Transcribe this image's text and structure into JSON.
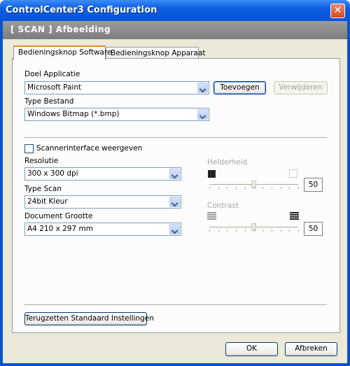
{
  "window": {
    "title": "ControlCenter3 Configuration",
    "close_glyph": "✕"
  },
  "header": {
    "text": "[ SCAN ]  Afbeelding"
  },
  "tabs": [
    {
      "label": "Bedieningsknop Software",
      "active": true
    },
    {
      "label": "Bedieningsknop Apparaat",
      "active": false
    }
  ],
  "target_app": {
    "label": "Doel Applicatie",
    "value": "Microsoft Paint",
    "add_button": "Toevoegen",
    "remove_button": "Verwijderen"
  },
  "file_type": {
    "label": "Type Bestand",
    "value": "Windows Bitmap (*.bmp)"
  },
  "scanner_interface": {
    "label": "Scannerinterface weergeven",
    "checked": false
  },
  "resolution": {
    "label": "Resolutie",
    "value": "300 x 300 dpi"
  },
  "scan_type": {
    "label": "Type Scan",
    "value": "24bit Kleur"
  },
  "document_size": {
    "label": "Document Grootte",
    "value": "A4 210 x 297 mm"
  },
  "brightness": {
    "label": "Helderheid",
    "value": "50",
    "level": 0.5,
    "enabled": false
  },
  "contrast": {
    "label": "Contrast",
    "value": "50",
    "level": 0.5,
    "enabled": false
  },
  "reset_button": "Terugzetten Standaard Instellingen",
  "footer": {
    "ok": "OK",
    "cancel": "Afbreken"
  },
  "colors": {
    "title_bar": "#0b5fe2",
    "header_band": "#8c8c8c",
    "dialog_bg": "#ece9d8",
    "active_tab_accent": "#e68b2c"
  }
}
